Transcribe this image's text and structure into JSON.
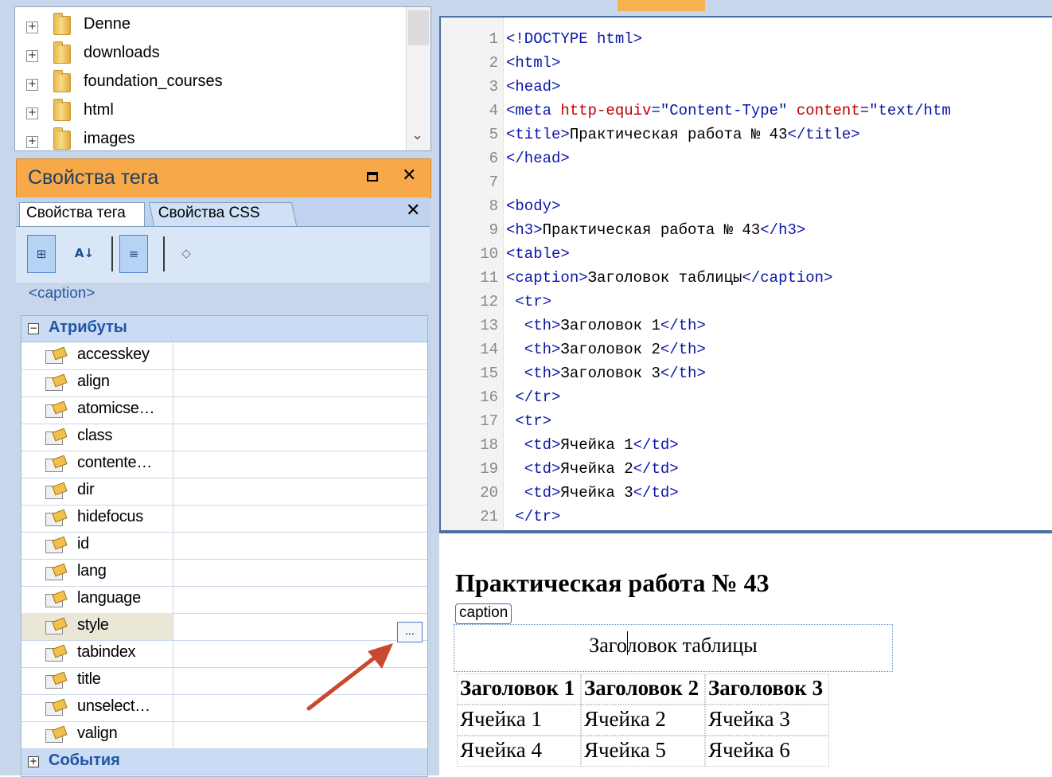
{
  "file_tree": {
    "items": [
      {
        "name": "Denne"
      },
      {
        "name": "downloads"
      },
      {
        "name": "foundation_courses"
      },
      {
        "name": "html"
      },
      {
        "name": "images"
      }
    ]
  },
  "tag_panel": {
    "title": "Свойства тега",
    "tabs": [
      {
        "label": "Свойства тега"
      },
      {
        "label": "Свойства CSS"
      }
    ],
    "toolbar": {
      "categorized": "⊞",
      "alphabetical": "A↓",
      "set_properties": "≡",
      "tag_icon": "◇"
    },
    "current_tag": "<caption>",
    "groups": {
      "attributes": {
        "label": "Атрибуты",
        "toggle": "−"
      },
      "events": {
        "label": "События",
        "toggle": "+"
      }
    },
    "properties": [
      {
        "name": "accesskey",
        "value": ""
      },
      {
        "name": "align",
        "value": ""
      },
      {
        "name": "atomicse…",
        "value": ""
      },
      {
        "name": "class",
        "value": ""
      },
      {
        "name": "contente…",
        "value": ""
      },
      {
        "name": "dir",
        "value": ""
      },
      {
        "name": "hidefocus",
        "value": ""
      },
      {
        "name": "id",
        "value": ""
      },
      {
        "name": "lang",
        "value": ""
      },
      {
        "name": "language",
        "value": ""
      },
      {
        "name": "style",
        "value": "",
        "selected": true
      },
      {
        "name": "tabindex",
        "value": ""
      },
      {
        "name": "title",
        "value": ""
      },
      {
        "name": "unselect…",
        "value": ""
      },
      {
        "name": "valign",
        "value": ""
      }
    ],
    "ellipsis": "..."
  },
  "code": {
    "lines": [
      {
        "n": "1"
      },
      {
        "n": "2"
      },
      {
        "n": "3"
      },
      {
        "n": "4"
      },
      {
        "n": "5"
      },
      {
        "n": "6"
      },
      {
        "n": "7"
      },
      {
        "n": "8"
      },
      {
        "n": "9"
      },
      {
        "n": "10"
      },
      {
        "n": "11"
      },
      {
        "n": "12"
      },
      {
        "n": "13"
      },
      {
        "n": "14"
      },
      {
        "n": "15"
      },
      {
        "n": "16"
      },
      {
        "n": "17"
      },
      {
        "n": "18"
      },
      {
        "n": "19"
      },
      {
        "n": "20"
      },
      {
        "n": "21"
      }
    ],
    "l1": "<!DOCTYPE html>",
    "l2": "<html>",
    "l3": "<head>",
    "l4_tag": "<meta ",
    "l4_attr1": "http-equiv",
    "l4_eq1": "=",
    "l4_val1": "\"Content-Type\"",
    "l4_attr2": " content",
    "l4_eq2": "=",
    "l4_val2": "\"text/htm",
    "l5_open": "<title>",
    "l5_text": "Практическая работа № 43",
    "l5_close": "</title>",
    "l6": "</head>",
    "l8": "<body>",
    "l9_open": "<h3>",
    "l9_text": "Практическая работа № 43",
    "l9_close": "</h3>",
    "l10": "<table>",
    "l11_open": "<caption>",
    "l11_text": "Заголовок таблицы",
    "l11_close": "</caption>",
    "l12": " <tr>",
    "l13_open": "  <th>",
    "l13_text": "Заголовок 1",
    "l13_close": "</th>",
    "l14_open": "  <th>",
    "l14_text": "Заголовок 2",
    "l14_close": "</th>",
    "l15_open": "  <th>",
    "l15_text": "Заголовок 3",
    "l15_close": "</th>",
    "l16": " </tr>",
    "l17": " <tr>",
    "l18_open": "  <td>",
    "l18_text": "Ячейка 1",
    "l18_close": "</td>",
    "l19_open": "  <td>",
    "l19_text": "Ячейка 2",
    "l19_close": "</td>",
    "l20_open": "  <td>",
    "l20_text": "Ячейка 3",
    "l20_close": "</td>",
    "l21": " </tr>"
  },
  "preview": {
    "heading": "Практическая работа № 43",
    "caption_badge": "caption",
    "caption": "Заголовок таблицы",
    "headers": [
      "Заголовок 1",
      "Заголовок 2",
      "Заголовок 3"
    ],
    "rows": [
      [
        "Ячейка 1",
        "Ячейка 2",
        "Ячейка 3"
      ],
      [
        "Ячейка 4",
        "Ячейка 5",
        "Ячейка 6"
      ]
    ]
  },
  "colors": {
    "panel_title_bg": "#f7a94a",
    "panel_bg": "#c7d6ea",
    "code_tag": "#0a16a8",
    "code_attr": "#c00000",
    "annotation_arrow": "#c84a2e"
  }
}
